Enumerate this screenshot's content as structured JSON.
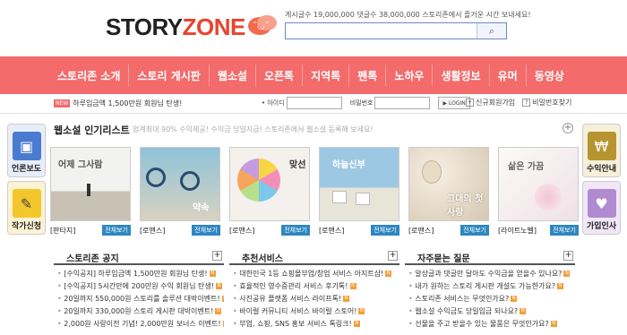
{
  "header": {
    "logo_story": "STORY",
    "logo_zone": "ZONE",
    "stats": "게시글수 19,000,000  댓글수 38,000,000  스토리존에서 즐거운 시간 보내세요!",
    "search_placeholder": ""
  },
  "nav": [
    "스토리존 소개",
    "스토리 게시판",
    "웹소설",
    "오픈톡",
    "지역톡",
    "펜톡",
    "노하우",
    "생활정보",
    "유머",
    "동영상"
  ],
  "strip": {
    "badge": "NEW",
    "news": "하루입금액 1,500만원 회원님 탄생!",
    "id_label": "• 아이디",
    "pw_label": "비밀번호",
    "login_button": "▶ LOGIN",
    "join": "신규회원가입",
    "find_pw": "비밀번호찾기"
  },
  "side_left": [
    {
      "label": "언론보도",
      "icon": "tv-icon",
      "color": "#4a7bd0"
    },
    {
      "label": "작가신청",
      "icon": "pencil-icon",
      "color": "#f3c72c"
    }
  ],
  "side_right": [
    {
      "label": "수익안내",
      "icon": "money-bag-icon",
      "color": "#b69531"
    },
    {
      "label": "가입인사",
      "icon": "hello-icon",
      "color": "#b08bd1"
    }
  ],
  "webnovel": {
    "title": "웹소설 인기리스트",
    "desc": "업계최대 90% 수익제공! 수익금 당일지급! 스토리존에서 웹소설 등록해 보세요!",
    "view_label": "전체보기",
    "items": [
      {
        "cover_text": "어제 그사람",
        "genre": "[판타지]"
      },
      {
        "cover_text": "약속",
        "genre": "[로맨스]"
      },
      {
        "cover_text": "맞선",
        "genre": "[로맨스]"
      },
      {
        "cover_text": "하늘신부",
        "genre": "[로맨스]"
      },
      {
        "cover_text": "그대의 첫사랑",
        "genre": "[로맨스]"
      },
      {
        "cover_text": "삶은 가끔",
        "genre": "[라이트노벨]"
      }
    ]
  },
  "notice": {
    "title": "스토리존 공지",
    "items": [
      "[수익공지] 하루입금액 1,500만원 회원님 탄생!",
      "[수익공지] 5시간만에 200만원 수익 회원님 탄생!",
      "20일까지 550,000원 스토리를 솔루션 대박이벤트!",
      "20일까지 330,000원 스토리 게시판 대박이벤트!",
      "2,000원 사랑이전 기념! 2,000만원 보너스 이벤트!"
    ]
  },
  "recommend": {
    "title": "추천서비스",
    "items": [
      "대한민국 1등 쇼핑몰부업/창업 서비스 아지트샵!",
      "효율적인 영수증관리 서비스 후기톡!",
      "사진공유 플랫폼 서비스 라이프톡!",
      "바이럴 커뮤니티 서비스 바이럴 스토어!",
      "부업, 쇼핑, SNS 홍보 서비스 톡링크!"
    ]
  },
  "faq": {
    "title": "자주묻는 질문",
    "items": [
      "알상글과 댓글만 달아도 수익금을 얻을수 있나요?",
      "내가 원하는 스토리 게시판 개설도 가능한가요?",
      "스토리존 서비스는 무엇인가요?",
      "웹소설 수익금도 당일입금 되나요?",
      "선물을 주고 받을수 있는 물품은 무엇인가요?"
    ]
  }
}
